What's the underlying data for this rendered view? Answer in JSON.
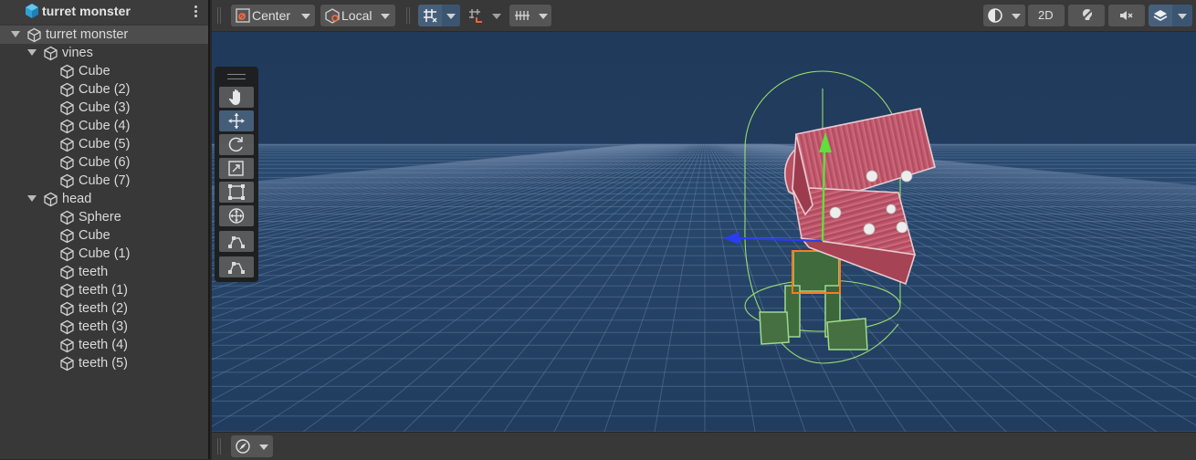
{
  "hierarchy": {
    "scene_title": "turret monster",
    "rows": [
      {
        "label": "turret monster",
        "depth": 0,
        "foldout": true,
        "selected": true
      },
      {
        "label": "vines",
        "depth": 1,
        "foldout": true
      },
      {
        "label": "Cube",
        "depth": 2
      },
      {
        "label": "Cube (2)",
        "depth": 2
      },
      {
        "label": "Cube (3)",
        "depth": 2
      },
      {
        "label": "Cube (4)",
        "depth": 2
      },
      {
        "label": "Cube (5)",
        "depth": 2
      },
      {
        "label": "Cube (6)",
        "depth": 2
      },
      {
        "label": "Cube (7)",
        "depth": 2
      },
      {
        "label": "head",
        "depth": 1,
        "foldout": true
      },
      {
        "label": "Sphere",
        "depth": 2
      },
      {
        "label": "Cube",
        "depth": 2
      },
      {
        "label": "Cube (1)",
        "depth": 2
      },
      {
        "label": "teeth",
        "depth": 2
      },
      {
        "label": "teeth (1)",
        "depth": 2
      },
      {
        "label": "teeth (2)",
        "depth": 2
      },
      {
        "label": "teeth (3)",
        "depth": 2
      },
      {
        "label": "teeth (4)",
        "depth": 2
      },
      {
        "label": "teeth (5)",
        "depth": 2
      }
    ]
  },
  "scene_toolbar": {
    "pivot_mode": "Center",
    "pivot_rotation": "Local",
    "mode_2d": "2D"
  },
  "tools": [
    "hand-tool",
    "move-tool",
    "rotate-tool",
    "scale-tool",
    "rect-tool",
    "transform-tool",
    "custom-tool-1",
    "custom-tool-2"
  ],
  "active_tool": "move-tool",
  "colors": {
    "sky": "#1f3a5a",
    "grid_line": "#5a7391",
    "model_red": "#c05066",
    "legs_green": "#3f6b3d",
    "gizmo_y": "#5fe03a",
    "gizmo_z": "#2a3df0",
    "collider": "#9be06a",
    "selection": "#ff7a1c"
  }
}
